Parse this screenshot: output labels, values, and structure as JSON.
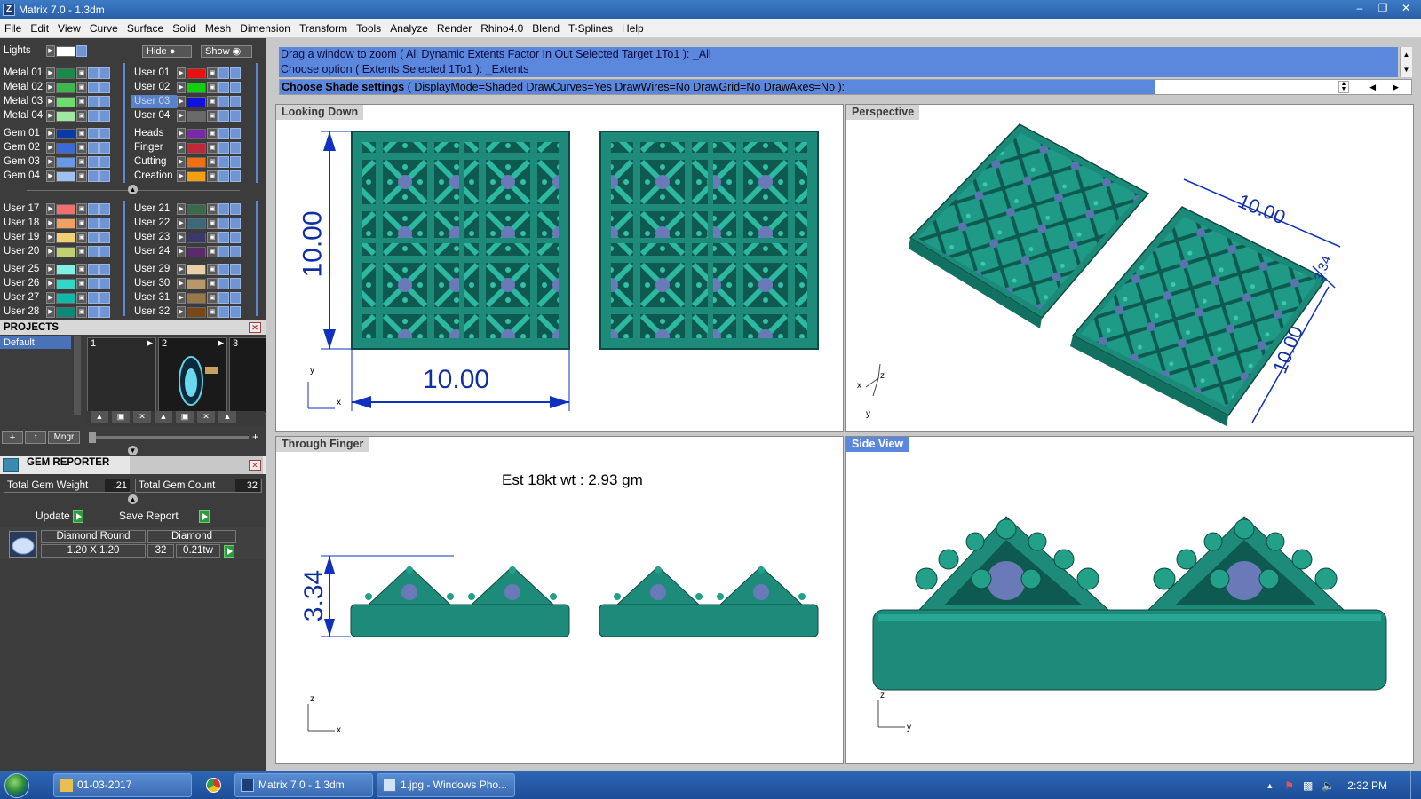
{
  "window": {
    "title": "Matrix 7.0 - 1.3dm",
    "buttons": [
      "minimize",
      "restore",
      "close"
    ]
  },
  "menu": [
    "File",
    "Edit",
    "View",
    "Curve",
    "Surface",
    "Solid",
    "Mesh",
    "Dimension",
    "Transform",
    "Tools",
    "Analyze",
    "Render",
    "Rhino4.0",
    "Blend",
    "T-Splines",
    "Help"
  ],
  "layers": {
    "lights_label": "Lights",
    "hide_label": "Hide",
    "show_label": "Show",
    "left": [
      {
        "name": "Metal 01",
        "color": "#1a8a4a"
      },
      {
        "name": "Metal 02",
        "color": "#3fb550"
      },
      {
        "name": "Metal 03",
        "color": "#6edc6e"
      },
      {
        "name": "Metal 04",
        "color": "#a0e8a0"
      },
      {
        "name": "Gem 01",
        "color": "#0a3aa8"
      },
      {
        "name": "Gem 02",
        "color": "#3a6ad8"
      },
      {
        "name": "Gem 03",
        "color": "#6a98e8"
      },
      {
        "name": "Gem 04",
        "color": "#a0c0f0"
      },
      {
        "name": "User 17",
        "color": "#f07070"
      },
      {
        "name": "User 18",
        "color": "#f0a060"
      },
      {
        "name": "User 19",
        "color": "#f0d070"
      },
      {
        "name": "User 20",
        "color": "#c0d070"
      },
      {
        "name": "User 25",
        "color": "#80f0e0"
      },
      {
        "name": "User 26",
        "color": "#30d8c8"
      },
      {
        "name": "User 27",
        "color": "#10b8a8"
      },
      {
        "name": "User 28",
        "color": "#108878"
      }
    ],
    "right": [
      {
        "name": "User 01",
        "color": "#e81010",
        "selected": false
      },
      {
        "name": "User 02",
        "color": "#10d010",
        "selected": false
      },
      {
        "name": "User 03",
        "color": "#1010e0",
        "selected": true
      },
      {
        "name": "User 04",
        "color": "#6a6a6a",
        "selected": false
      },
      {
        "name": "Heads",
        "color": "#7a28a8",
        "selected": false
      },
      {
        "name": "Finger",
        "color": "#c02838",
        "selected": false
      },
      {
        "name": "Cutting",
        "color": "#f07010",
        "selected": false
      },
      {
        "name": "Creation",
        "color": "#f0a010",
        "selected": false
      },
      {
        "name": "User 21",
        "color": "#3a6a4a",
        "selected": false
      },
      {
        "name": "User 22",
        "color": "#3a6a7a",
        "selected": false
      },
      {
        "name": "User 23",
        "color": "#3a3a6a",
        "selected": false
      },
      {
        "name": "User 24",
        "color": "#5a2a6a",
        "selected": false
      },
      {
        "name": "User 29",
        "color": "#e8d0a8",
        "selected": false
      },
      {
        "name": "User 30",
        "color": "#b89868",
        "selected": false
      },
      {
        "name": "User 31",
        "color": "#987848",
        "selected": false
      },
      {
        "name": "User 32",
        "color": "#784818",
        "selected": false
      }
    ]
  },
  "projects": {
    "title": "PROJECTS",
    "default_item": "Default",
    "slots": [
      "1",
      "2",
      "3"
    ],
    "mngr_label": "Mngr"
  },
  "gem_reporter": {
    "title": "GEM REPORTER",
    "total_weight_label": "Total Gem Weight",
    "total_weight_value": ".21",
    "total_count_label": "Total Gem Count",
    "total_count_value": "32",
    "update_label": "Update",
    "save_label": "Save Report",
    "gem": {
      "cut": "Diamond Round",
      "type": "Diamond",
      "size": "1.20 X 1.20",
      "count": "32",
      "weight": "0.21tw"
    }
  },
  "command": {
    "line1": "Drag a window to zoom ( All  Dynamic  Extents  Factor  In  Out  Selected  Target  1To1 ): _All",
    "line2": "Choose option ( Extents  Selected  1To1 ): _Extents",
    "prompt_bold": "Choose Shade settings",
    "prompt_rest": " ( DisplayMode=Shaded  DrawCurves=Yes  DrawWires=No  DrawGrid=No  DrawAxes=No ):"
  },
  "viewports": {
    "top_left": {
      "label": "Looking Down",
      "dim_h": "10.00",
      "dim_v": "10.00"
    },
    "top_right": {
      "label": "Perspective",
      "dim_a": "10.00",
      "dim_b": "3.34",
      "dim_c": "10.00"
    },
    "bottom_left": {
      "label": "Through Finger",
      "estimate": "Est 18kt wt : 2.93 gm",
      "dim_v": "3.34"
    },
    "bottom_right": {
      "label": "Side View",
      "active": true
    }
  },
  "axes": {
    "x": "x",
    "y": "y",
    "z": "z"
  },
  "taskbar": {
    "items": [
      "01-03-2017",
      "Matrix 7.0 - 1.3dm",
      "1.jpg - Windows Pho..."
    ],
    "clock": "2:32 PM"
  }
}
